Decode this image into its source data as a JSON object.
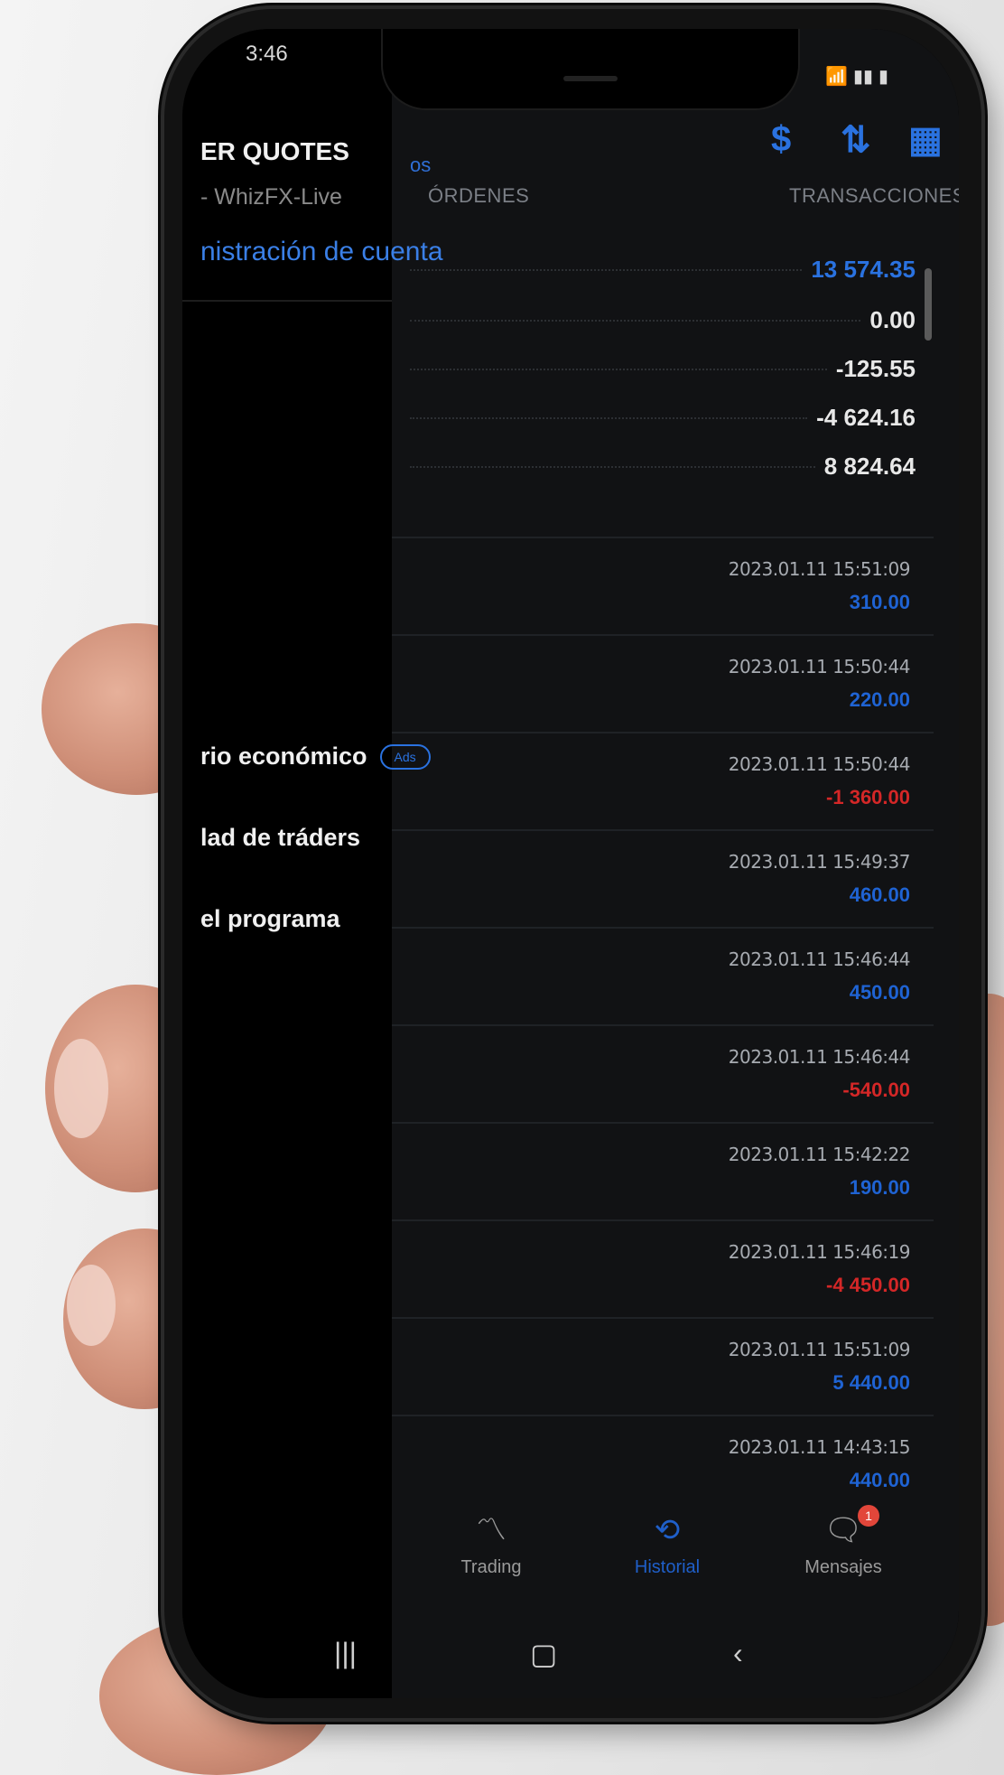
{
  "status_bar": {
    "time": "3:46",
    "icons": [
      "wifi-icon",
      "signal-icon",
      "battery-icon"
    ]
  },
  "drawer": {
    "title": "ER QUOTES",
    "subtitle": "- WhizFX-Live",
    "account_link": "nistración de cuenta",
    "menu": [
      {
        "label": "rio económico",
        "badge": "Ads"
      },
      {
        "label": "lad de tráders"
      },
      {
        "label": "el programa"
      }
    ]
  },
  "main": {
    "tab_partial": "os",
    "tabs": [
      "ÓRDENES",
      "TRANSACCIONES"
    ],
    "top_icons": [
      "currency-swap-icon",
      "sort-icon",
      "calendar-icon"
    ],
    "summary_values": [
      {
        "value": "13 574.35",
        "color": "blue"
      },
      {
        "value": "0.00"
      },
      {
        "value": "-125.55"
      },
      {
        "value": "-4 624.16"
      },
      {
        "value": "8 824.64"
      }
    ],
    "deals": [
      {
        "time": "2023.01.11 15:51:09",
        "amount": "310.00",
        "sign": "pos"
      },
      {
        "time": "2023.01.11 15:50:44",
        "amount": "220.00",
        "sign": "pos"
      },
      {
        "time": "2023.01.11 15:50:44",
        "amount": "-1 360.00",
        "sign": "neg"
      },
      {
        "time": "2023.01.11 15:49:37",
        "amount": "460.00",
        "sign": "pos"
      },
      {
        "time": "2023.01.11 15:46:44",
        "amount": "450.00",
        "sign": "pos"
      },
      {
        "time": "2023.01.11 15:46:44",
        "amount": "-540.00",
        "sign": "neg"
      },
      {
        "time": "2023.01.11 15:42:22",
        "amount": "190.00",
        "sign": "pos"
      },
      {
        "time": "2023.01.11 15:46:19",
        "amount": "-4 450.00",
        "sign": "neg"
      },
      {
        "time": "2023.01.11 15:51:09",
        "amount": "5 440.00",
        "sign": "pos"
      },
      {
        "time": "2023.01.11 14:43:15",
        "amount": "440.00",
        "sign": "pos"
      }
    ]
  },
  "bottom_nav": {
    "items": [
      {
        "label": "Trading",
        "icon": "chart-line-icon",
        "active": false
      },
      {
        "label": "Historial",
        "icon": "history-icon",
        "active": true
      },
      {
        "label": "Mensajes",
        "icon": "chat-icon",
        "active": false,
        "badge": "1"
      }
    ]
  },
  "colors": {
    "accent_blue": "#2a72e0",
    "negative_red": "#d42727",
    "background": "#111214"
  }
}
